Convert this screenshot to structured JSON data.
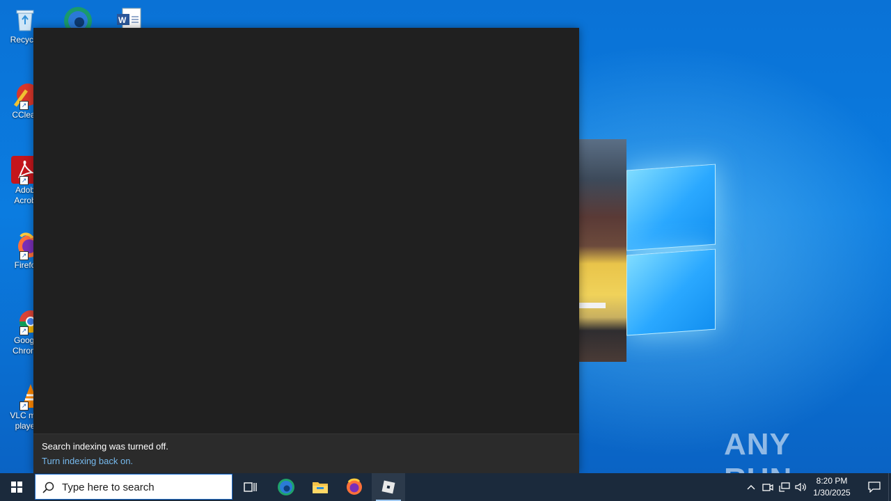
{
  "desktop": {
    "icons": [
      {
        "label": "Recycle",
        "icon": "recycle-bin-icon"
      },
      {
        "label": "CClear",
        "icon": "ccleaner-icon"
      },
      {
        "label": "Adob\nAcrob",
        "line1": "Adob",
        "line2": "Acrob",
        "icon": "adobe-acrobat-icon"
      },
      {
        "label": "Firefo",
        "icon": "firefox-icon"
      },
      {
        "label": "Googl\nChrom",
        "line1": "Googl",
        "line2": "Chrom",
        "icon": "chrome-icon"
      },
      {
        "label": "VLC me\nplaye",
        "line1": "VLC me",
        "line2": "playe",
        "icon": "vlc-icon"
      }
    ],
    "top_icons": [
      "edge-desktop-icon",
      "word-document-icon"
    ]
  },
  "search_panel": {
    "indexing_message": "Search indexing was turned off.",
    "indexing_link": "Turn indexing back on."
  },
  "watermark": {
    "text": "ANY RUN",
    "part1": "ANY",
    "part2": "RUN"
  },
  "taskbar": {
    "search_placeholder": "Type here to search",
    "pinned": [
      "task-view-icon",
      "edge-icon",
      "file-explorer-icon",
      "firefox-icon",
      "roblox-icon"
    ],
    "clock": {
      "time": "8:20 PM",
      "date": "1/30/2025"
    },
    "colors": {
      "taskbar": "#1b2a3c",
      "accent": "#76b9ed"
    }
  }
}
